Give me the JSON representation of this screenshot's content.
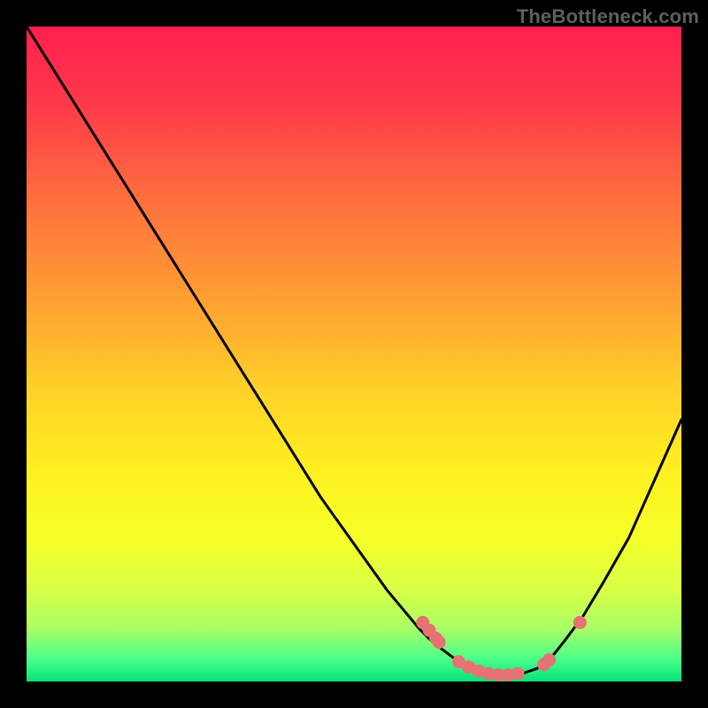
{
  "watermark": "TheBottleneck.com",
  "chart_data": {
    "type": "line",
    "title": "",
    "xlabel": "",
    "ylabel": "",
    "xlim": [
      0,
      100
    ],
    "ylim": [
      0,
      100
    ],
    "grid": false,
    "legend": false,
    "series": [
      {
        "name": "curve",
        "x": [
          0,
          5,
          10,
          15,
          20,
          25,
          30,
          35,
          40,
          45,
          50,
          55,
          60,
          62,
          64,
          66,
          68,
          70,
          72,
          74,
          76,
          78,
          80,
          82,
          85,
          88,
          92,
          96,
          100
        ],
        "y": [
          100,
          92,
          84,
          76,
          68,
          60,
          52,
          44,
          36,
          28,
          21,
          14,
          8,
          6,
          4.5,
          3,
          2,
          1.3,
          1,
          1,
          1.3,
          2,
          3.5,
          6,
          10,
          15,
          22,
          31,
          40
        ]
      }
    ],
    "markers": {
      "name": "flat-zone-points",
      "x": [
        60.5,
        61.5,
        62.5,
        63,
        66,
        67.5,
        69,
        70.5,
        72,
        73.5,
        75,
        79,
        79.8,
        84.5
      ],
      "y": [
        9,
        7.8,
        6.6,
        6,
        3,
        2.2,
        1.6,
        1.2,
        1,
        1,
        1.2,
        2.6,
        3.3,
        9
      ]
    },
    "background_gradient": {
      "stops": [
        {
          "pos": 0.0,
          "color": "#ff1f4f"
        },
        {
          "pos": 0.12,
          "color": "#ff3a4a"
        },
        {
          "pos": 0.25,
          "color": "#ff6a3f"
        },
        {
          "pos": 0.4,
          "color": "#ff9a33"
        },
        {
          "pos": 0.55,
          "color": "#ffd028"
        },
        {
          "pos": 0.68,
          "color": "#fff020"
        },
        {
          "pos": 0.78,
          "color": "#f6ff28"
        },
        {
          "pos": 0.86,
          "color": "#d8ff46"
        },
        {
          "pos": 0.92,
          "color": "#a8ff66"
        },
        {
          "pos": 0.965,
          "color": "#4cff8a"
        },
        {
          "pos": 1.0,
          "color": "#05e37a"
        }
      ]
    },
    "colors": {
      "curve": "#000000",
      "markers": "#e57373",
      "frame": "#000000"
    }
  }
}
